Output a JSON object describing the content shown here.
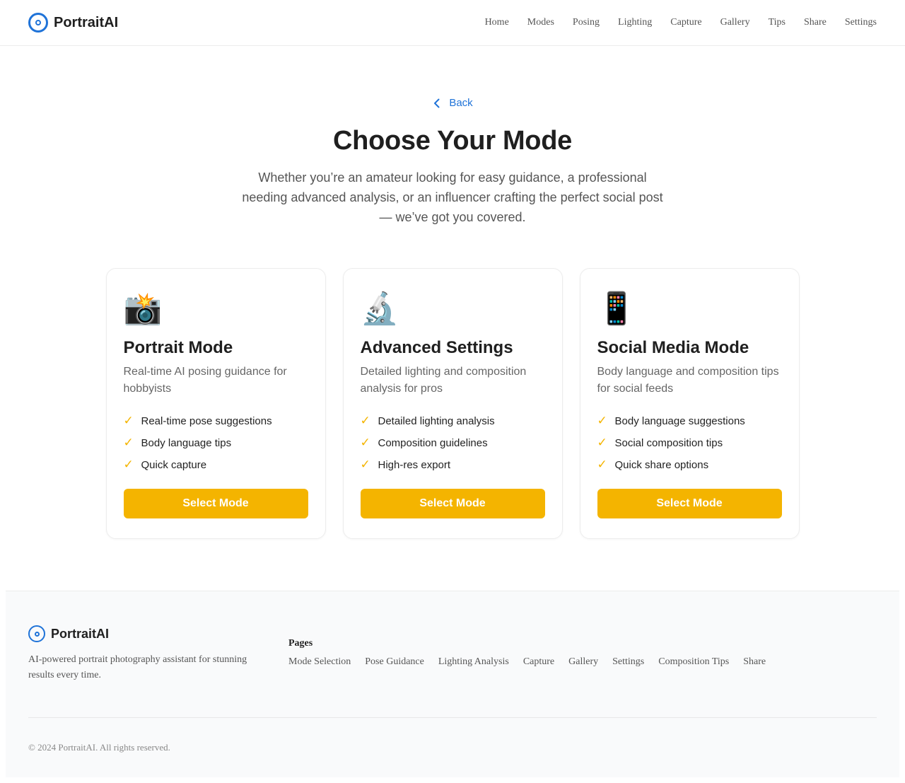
{
  "header": {
    "brand": "PortraitAI",
    "brand_icon": "target-icon",
    "nav": [
      "Home",
      "Modes",
      "Posing",
      "Lighting",
      "Capture",
      "Gallery",
      "Tips",
      "Share",
      "Settings"
    ]
  },
  "hero": {
    "back_label": "Back",
    "title": "Choose Your Mode",
    "subtitle": "Whether you’re an amateur looking for easy guidance, a professional needing advanced analysis, or an influencer crafting the perfect social post — we’ve got you covered."
  },
  "cards": [
    {
      "emoji": "📸",
      "icon": "camera-flash-icon",
      "title": "Portrait Mode",
      "description": "Real-time AI posing guidance for hobbyists",
      "features": [
        "Real-time pose suggestions",
        "Body language tips",
        "Quick capture"
      ],
      "button": "Select Mode"
    },
    {
      "emoji": "🔬",
      "icon": "microscope-icon",
      "title": "Advanced Settings",
      "description": "Detailed lighting and composition analysis for pros",
      "features": [
        "Detailed lighting analysis",
        "Composition guidelines",
        "High-res export"
      ],
      "button": "Select Mode"
    },
    {
      "emoji": "📱",
      "icon": "mobile-phone-icon",
      "title": "Social Media Mode",
      "description": "Body language and composition tips for social feeds",
      "features": [
        "Body language suggestions",
        "Social composition tips",
        "Quick share options"
      ],
      "button": "Select Mode"
    }
  ],
  "check_glyph": "✓",
  "footer": {
    "brand": "PortraitAI",
    "tagline": "AI-powered portrait photography assistant for stunning results every time.",
    "pages_heading": "Pages",
    "pages": [
      "Mode Selection",
      "Pose Guidance",
      "Lighting Analysis",
      "Capture",
      "Gallery",
      "Settings",
      "Composition Tips",
      "Share"
    ],
    "copyright": "© 2024 PortraitAI. All rights reserved."
  },
  "colors": {
    "accent": "#1f73d8",
    "button": "#f4b400",
    "check": "#f4b400"
  }
}
